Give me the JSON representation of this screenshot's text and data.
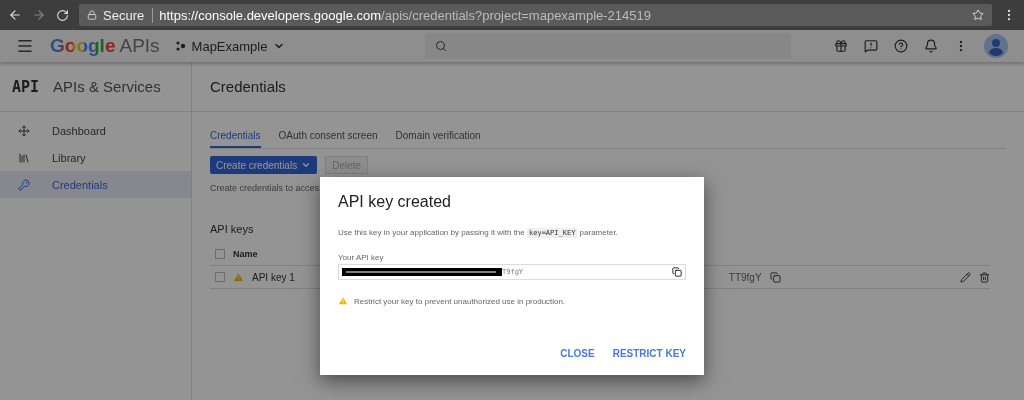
{
  "browser": {
    "secure_label": "Secure",
    "url_host": "https://console.developers.google.com",
    "url_path": "/apis/credentials?project=mapexample-214519"
  },
  "header": {
    "logo": "Google",
    "product": "APIs",
    "project": "MapExample"
  },
  "sidebar": {
    "logo": "API",
    "title": "APIs & Services",
    "items": [
      {
        "label": "Dashboard",
        "kind": "dashboard",
        "selected": false
      },
      {
        "label": "Library",
        "kind": "library",
        "selected": false
      },
      {
        "label": "Credentials",
        "kind": "key",
        "selected": true
      }
    ]
  },
  "main": {
    "title": "Credentials",
    "tabs": [
      {
        "label": "Credentials",
        "selected": true
      },
      {
        "label": "OAuth consent screen",
        "selected": false
      },
      {
        "label": "Domain verification",
        "selected": false
      }
    ],
    "create_button": "Create credentials",
    "delete_button": {
      "label": "Delete",
      "disabled": true
    },
    "description": "Create credentials to acces",
    "section_title": "API keys",
    "table": {
      "columns": [
        "Name"
      ],
      "header_checked": false,
      "rows": [
        {
          "name": "API key 1",
          "key": "TT9fgY",
          "checked": false,
          "warning": true
        }
      ]
    }
  },
  "dialog": {
    "title": "API key created",
    "message_before": "Use this key in your application by passing it with the",
    "message_code": "key=API_KEY",
    "message_after": "parameter.",
    "field_label": "Your API key",
    "field_value": "T9fgY",
    "warning": "Restrict your key to prevent unauthorized use in production.",
    "actions": [
      "CLOSE",
      "RESTRICT KEY"
    ]
  }
}
